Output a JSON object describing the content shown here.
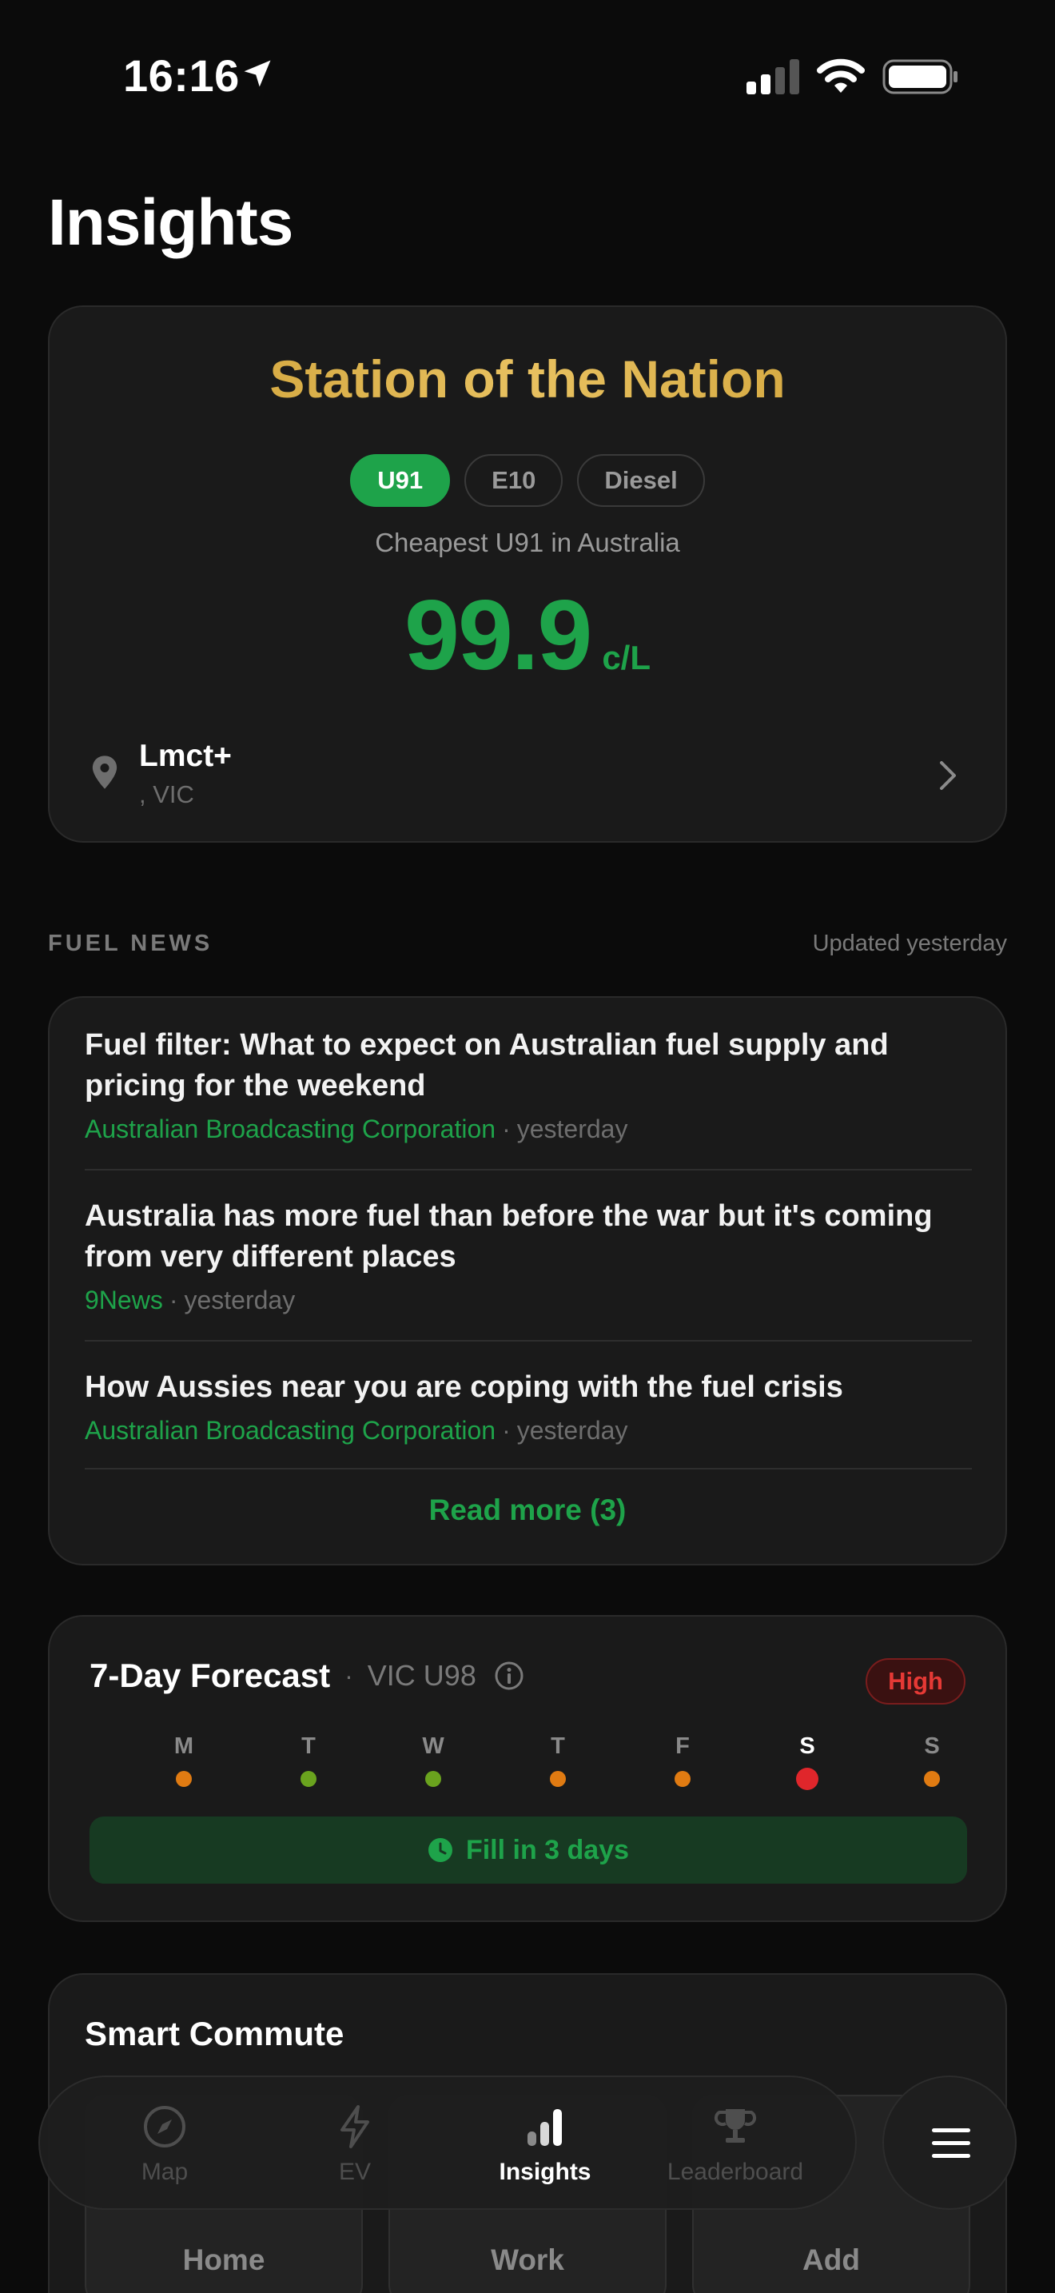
{
  "status_bar": {
    "time": "16:16"
  },
  "page": {
    "title": "Insights"
  },
  "station": {
    "title": "Station of the Nation",
    "fuel_tabs": [
      "U91",
      "E10",
      "Diesel"
    ],
    "active_fuel": "U91",
    "cheapest_label": "Cheapest U91 in Australia",
    "price": "99.9",
    "unit": "c/L",
    "name": "Lmct+",
    "region": ", VIC"
  },
  "news": {
    "section_label": "FUEL NEWS",
    "updated": "Updated yesterday",
    "items": [
      {
        "title": "Fuel filter: What to expect on Australian fuel supply and pricing for the weekend",
        "source": "Australian Broadcasting Corporation",
        "time": "yesterday"
      },
      {
        "title": "Australia has more fuel than before the war but it's coming from very different places",
        "source": "9News",
        "time": "yesterday"
      },
      {
        "title": "How Aussies near you are coping with the fuel crisis",
        "source": "Australian Broadcasting Corporation",
        "time": "yesterday"
      }
    ],
    "read_more": "Read more (3)"
  },
  "forecast": {
    "title": "7-Day Forecast",
    "separator": "·",
    "region": "VIC U98",
    "badge": "High",
    "days": [
      {
        "label": "M",
        "level": "orange"
      },
      {
        "label": "T",
        "level": "green"
      },
      {
        "label": "W",
        "level": "green"
      },
      {
        "label": "T",
        "level": "orange"
      },
      {
        "label": "F",
        "level": "orange"
      },
      {
        "label": "S",
        "level": "red",
        "today": true
      },
      {
        "label": "S",
        "level": "orange"
      }
    ],
    "fill_advice": "Fill in 3 days",
    "colors": {
      "green": "#6aa31e",
      "orange": "#e07b12",
      "red": "#e0262b"
    }
  },
  "commute": {
    "title": "Smart Commute",
    "buttons": [
      "Home",
      "Work",
      "Add"
    ]
  },
  "tab_bar": {
    "items": [
      {
        "label": "Map",
        "icon": "compass-icon"
      },
      {
        "label": "EV",
        "icon": "lightning-icon"
      },
      {
        "label": "Insights",
        "icon": "bar-chart-icon",
        "active": true
      },
      {
        "label": "Leaderboard",
        "icon": "trophy-icon"
      }
    ]
  },
  "theme": {
    "accent": "#1ea34a",
    "gold": "#e0b84a",
    "background": "#0b0b0b",
    "card": "#1a1a1a"
  }
}
